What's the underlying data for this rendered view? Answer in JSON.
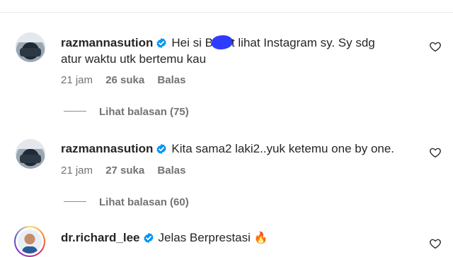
{
  "comments": [
    {
      "username": "razmannasution",
      "text_before": "Hei si B",
      "text_after": "t lihat Instagram sy. Sy sdg",
      "text_line2": "atur waktu utk bertemu kau",
      "time": "21 jam",
      "likes": "26 suka",
      "reply": "Balas",
      "view_replies": "Lihat balasan (75)"
    },
    {
      "username": "razmannasution",
      "text": "Kita sama2 laki2..yuk ketemu one by one.",
      "time": "21 jam",
      "likes": "27 suka",
      "reply": "Balas",
      "view_replies": "Lihat balasan (60)"
    },
    {
      "username": "dr.richard_lee",
      "text": "Jelas Berprestasi",
      "emoji": "🔥"
    }
  ],
  "colors": {
    "verified": "#0095f6",
    "muted": "#737373",
    "redaction": "#2d3cff"
  },
  "icons": {
    "like": "heart-outline-icon",
    "verified": "verified-badge-icon"
  }
}
